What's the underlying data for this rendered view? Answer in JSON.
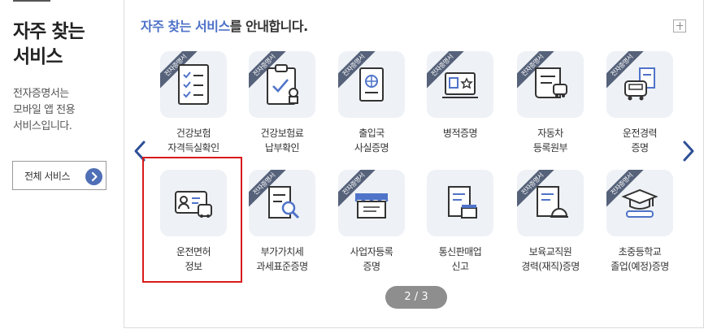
{
  "sidebar": {
    "title_line1": "자주 찾는",
    "title_line2": "서비스",
    "desc_line1": "전자증명서는",
    "desc_line2": "모바일 앱 전용",
    "desc_line3": "서비스입니다.",
    "all_services_label": "전체 서비스",
    "arrow_icon": "chevron-right-icon"
  },
  "panel": {
    "heading_highlight": "자주 찾는 서비스",
    "heading_rest": "를 안내합니다.",
    "expand_icon": "plus-icon",
    "pager": "2 / 3"
  },
  "badge_text": "전자증명서",
  "colors": {
    "accent": "#4f73c8",
    "badge": "#56627a",
    "tile_bg": "#eef1f5",
    "highlight": "#d81b1b",
    "pager_bg": "#8e8e8e"
  },
  "services": [
    {
      "line1": "건강보험",
      "line2": "자격득실확인",
      "icon": "checklist-icon",
      "badge": true
    },
    {
      "line1": "건강보험료",
      "line2": "납부확인",
      "icon": "clipboard-check-icon",
      "badge": true
    },
    {
      "line1": "출입국",
      "line2": "사실증명",
      "icon": "passport-icon",
      "badge": true
    },
    {
      "line1": "병적증명",
      "line2": "",
      "icon": "military-id-icon",
      "badge": true
    },
    {
      "line1": "자동차",
      "line2": "등록원부",
      "icon": "car-document-icon",
      "badge": true
    },
    {
      "line1": "운전경력",
      "line2": "증명",
      "icon": "car-record-icon",
      "badge": true
    },
    {
      "line1": "운전면허",
      "line2": "정보",
      "icon": "driver-license-icon",
      "badge": false
    },
    {
      "line1": "부가가치세",
      "line2": "과세표준증명",
      "icon": "document-search-icon",
      "badge": true
    },
    {
      "line1": "사업자등록",
      "line2": "증명",
      "icon": "storefront-icon",
      "badge": true
    },
    {
      "line1": "통신판매업",
      "line2": "신고",
      "icon": "shop-document-icon",
      "badge": false
    },
    {
      "line1": "보육교직원",
      "line2": "경력(재직)증명",
      "icon": "helmet-document-icon",
      "badge": true
    },
    {
      "line1": "초중등학교",
      "line2": "졸업(예정)증명",
      "icon": "graduation-cap-icon",
      "badge": true
    }
  ]
}
